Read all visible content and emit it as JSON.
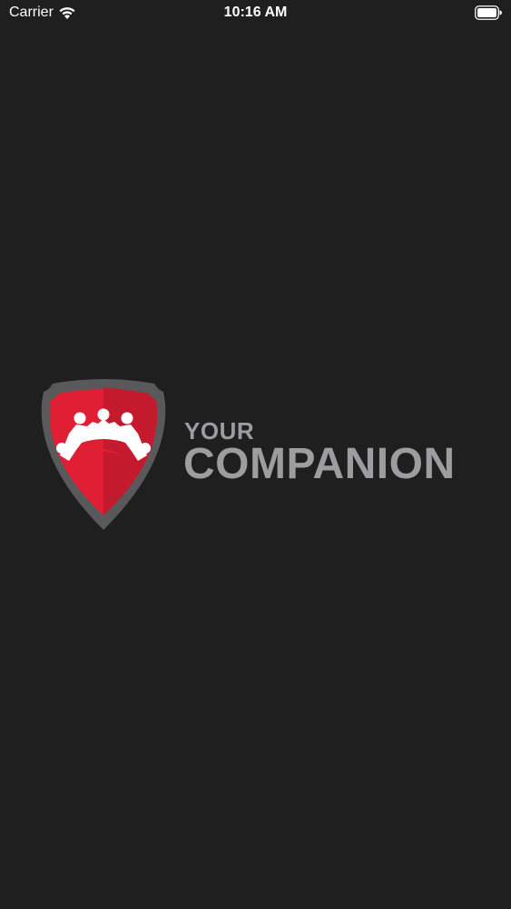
{
  "status_bar": {
    "carrier": "Carrier",
    "time": "10:16 AM",
    "icons": [
      "wifi-icon",
      "battery-icon"
    ]
  },
  "logo": {
    "line1": "YOUR",
    "line2": "COMPANION",
    "icon": "shield-icon"
  },
  "colors": {
    "background": "#201f20",
    "shield_border": "#59585a",
    "shield_red": "#e01f35",
    "shield_red_dark": "#c41a2e",
    "brand_text": "#9d9c9e",
    "status_text": "#ffffff"
  }
}
